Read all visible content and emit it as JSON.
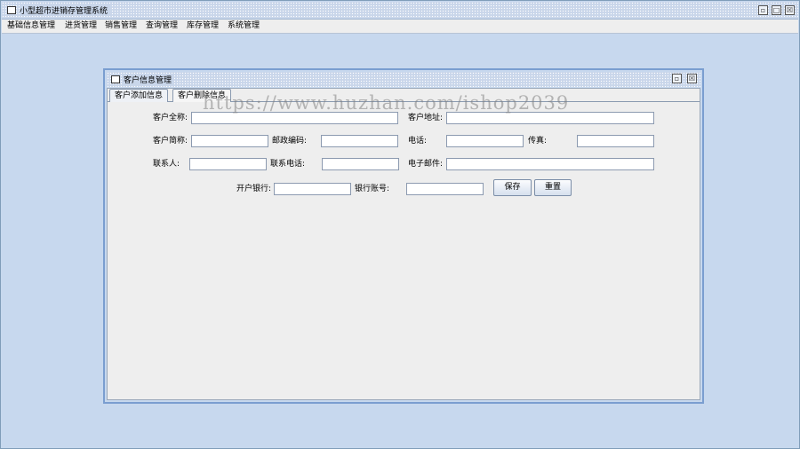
{
  "app": {
    "title": "小型超市进销存管理系统",
    "controls": {
      "restore": "▫",
      "maximize": "□",
      "close": "☒"
    }
  },
  "menubar": {
    "items": [
      "基础信息管理",
      "进货管理",
      "销售管理",
      "查询管理",
      "库存管理",
      "系统管理"
    ]
  },
  "frame": {
    "title": "客户信息管理",
    "controls": {
      "restore": "▫",
      "close": "☒"
    }
  },
  "tabs": [
    "客户添加信息",
    "客户删除信息"
  ],
  "form": {
    "full_name_label": "客户全称:",
    "address_label": "客户地址:",
    "short_name_label": "客户简称:",
    "postcode_label": "邮政编码:",
    "phone_label": "电话:",
    "fax_label": "传真:",
    "contact_label": "联系人:",
    "contact_phone_label": "联系电话:",
    "email_label": "电子邮件:",
    "bank_label": "开户银行:",
    "account_label": "银行账号:",
    "values": {
      "full_name": "",
      "address": "",
      "short_name": "",
      "postcode": "",
      "phone": "",
      "fax": "",
      "contact": "",
      "contact_phone": "",
      "email": "",
      "bank": "",
      "account": ""
    }
  },
  "buttons": {
    "save": "保存",
    "reset": "重置"
  },
  "watermark": "https://www.huzhan.com/ishop2039"
}
